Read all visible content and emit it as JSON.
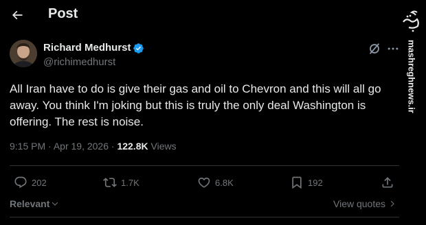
{
  "header": {
    "title": "Post"
  },
  "tweet": {
    "author_name": "Richard Medhurst",
    "handle": "@richimedhurst",
    "text": "All Iran have to do is give their gas and oil to Chevron and this will all go away. You think I'm joking but this is truly the only deal Washington is offering. The rest is noise.",
    "time": "9:15 PM",
    "separator": "·",
    "date": "Apr 19, 2026",
    "views_count": "122.8K",
    "views_label": "Views"
  },
  "actions": {
    "replies": "202",
    "reposts": "1.7K",
    "likes": "6.8K",
    "bookmarks": "192"
  },
  "footer": {
    "sort_label": "Relevant",
    "view_quotes_label": "View quotes"
  },
  "watermark": {
    "logo_text": "مشرق",
    "site_text": "mashreghnews.ir"
  },
  "colors": {
    "background": "#000000",
    "text": "#e7e9ea",
    "muted": "#71767b",
    "verified": "#1d9bf0",
    "divider": "#2f3336"
  },
  "icons": [
    "back-arrow-icon",
    "verified-badge-icon",
    "grok-icon",
    "more-icon",
    "reply-icon",
    "repost-icon",
    "like-icon",
    "bookmark-icon",
    "share-icon",
    "chevron-down-icon",
    "chevron-right-icon"
  ]
}
